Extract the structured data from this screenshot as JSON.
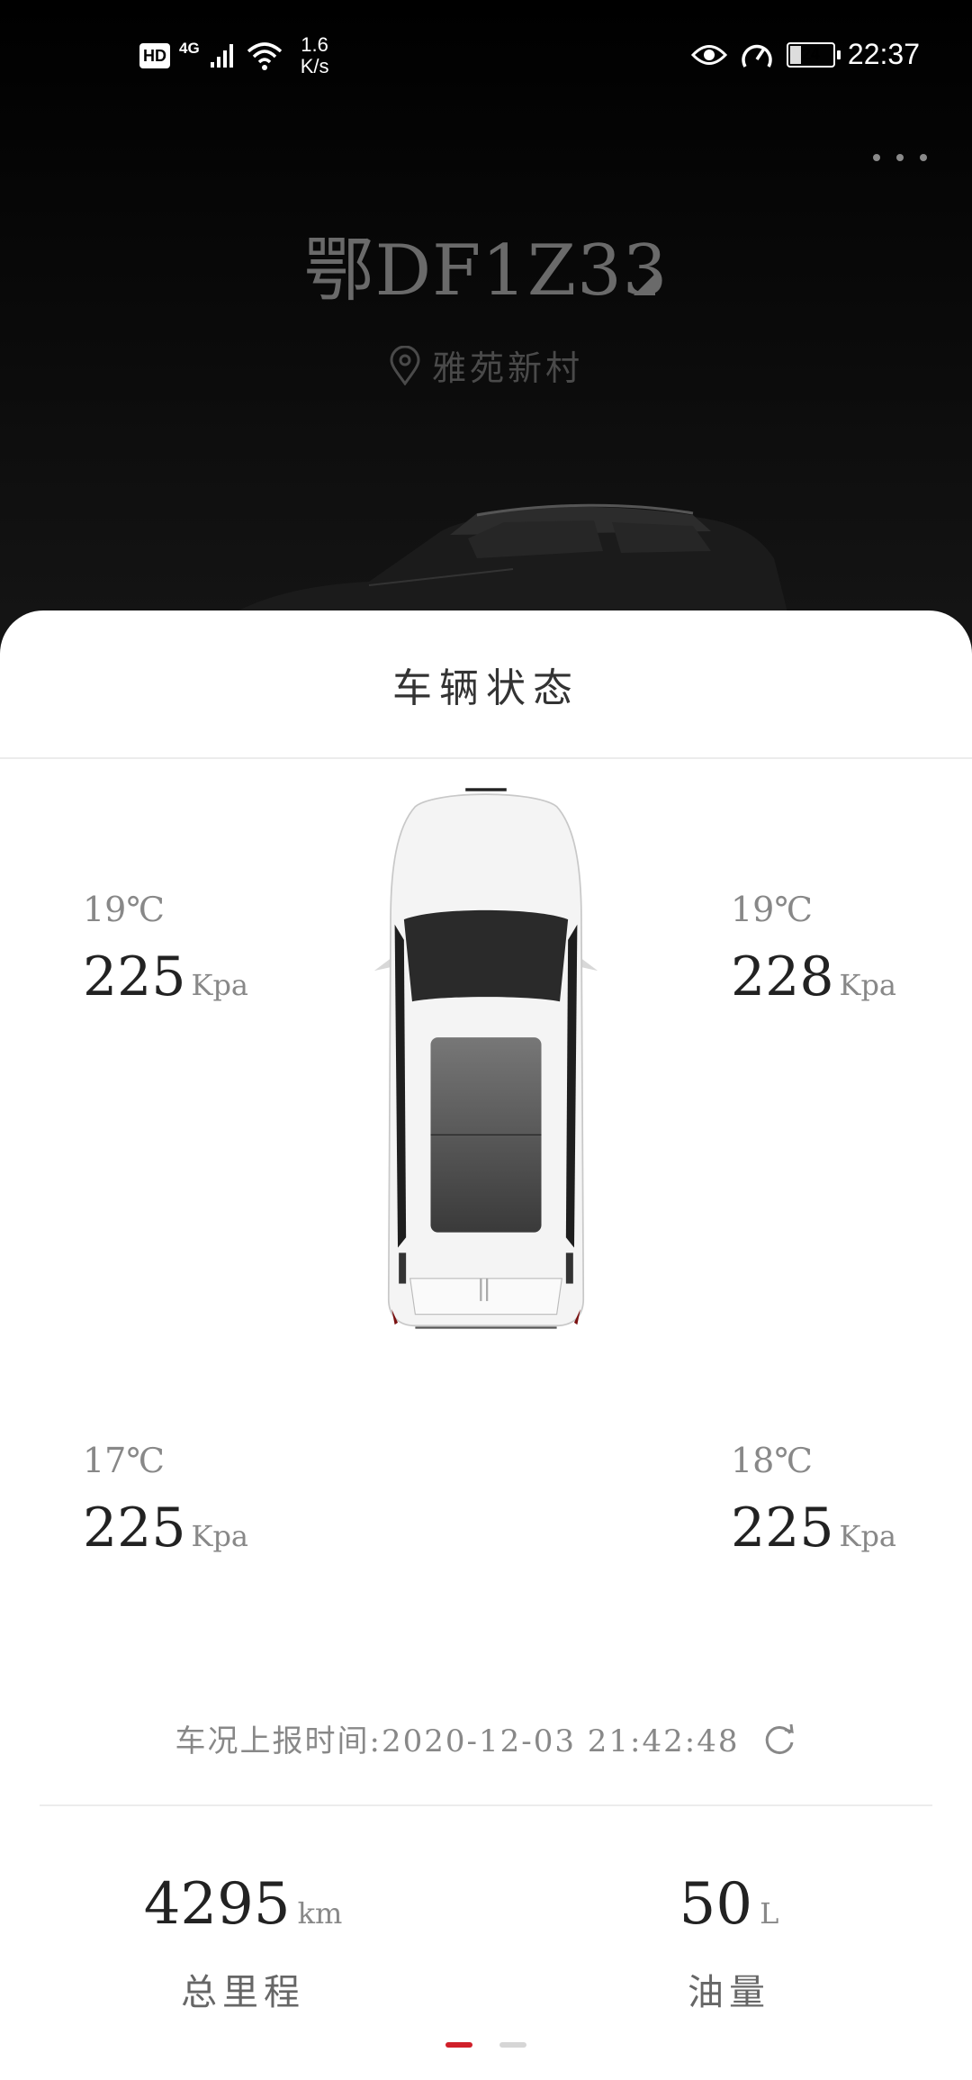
{
  "status_bar": {
    "hd": "HD",
    "network": "4G",
    "speed_value": "1.6",
    "speed_unit": "K/s",
    "battery": "24",
    "battery_level": 0.24,
    "time": "22:37"
  },
  "header": {
    "plate": "鄂DF1Z33",
    "location": "雅苑新村",
    "more_icon": "more-dots-icon"
  },
  "sheet": {
    "title": "车辆状态"
  },
  "tires": {
    "front_left": {
      "temp": "19℃",
      "pressure": "225",
      "unit": "Kpa"
    },
    "front_right": {
      "temp": "19℃",
      "pressure": "228",
      "unit": "Kpa"
    },
    "rear_left": {
      "temp": "17℃",
      "pressure": "225",
      "unit": "Kpa"
    },
    "rear_right": {
      "temp": "18℃",
      "pressure": "225",
      "unit": "Kpa"
    }
  },
  "report": {
    "label": "车况上报时间:",
    "time": "2020-12-03 21:42:48",
    "icon": "refresh-icon"
  },
  "stats": {
    "mileage": {
      "value": "4295",
      "unit": "km",
      "label": "总里程"
    },
    "fuel": {
      "value": "50",
      "unit": "L",
      "label": "油量"
    }
  },
  "pager": {
    "count": 2,
    "active": 0
  },
  "colors": {
    "accent": "#d0202a",
    "background_dark": "#000000",
    "sheet": "#ffffff"
  }
}
